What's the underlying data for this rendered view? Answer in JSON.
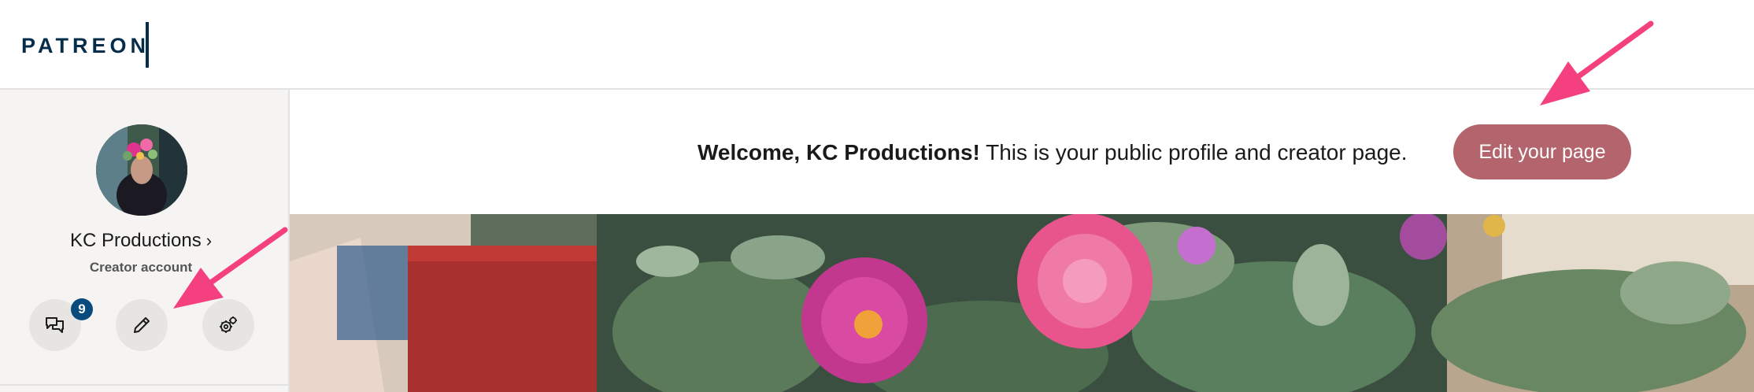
{
  "brand": {
    "logo_text": "PATREON"
  },
  "sidebar": {
    "account_name": "KC Productions",
    "account_type": "Creator account",
    "messages_badge": "9",
    "icons": {
      "messages": "messages-icon",
      "edit": "pencil-icon",
      "settings": "gear-icon",
      "chevron": "chevron-right-icon"
    }
  },
  "welcome": {
    "greeting_bold": "Welcome, KC Productions!",
    "greeting_rest": " This is your public profile and creator page.",
    "edit_button": "Edit your page"
  },
  "colors": {
    "brand_navy": "#052d49",
    "edit_button": "#b3646d",
    "badge": "#0b4a7c",
    "annotation_arrow": "#f5407f"
  }
}
